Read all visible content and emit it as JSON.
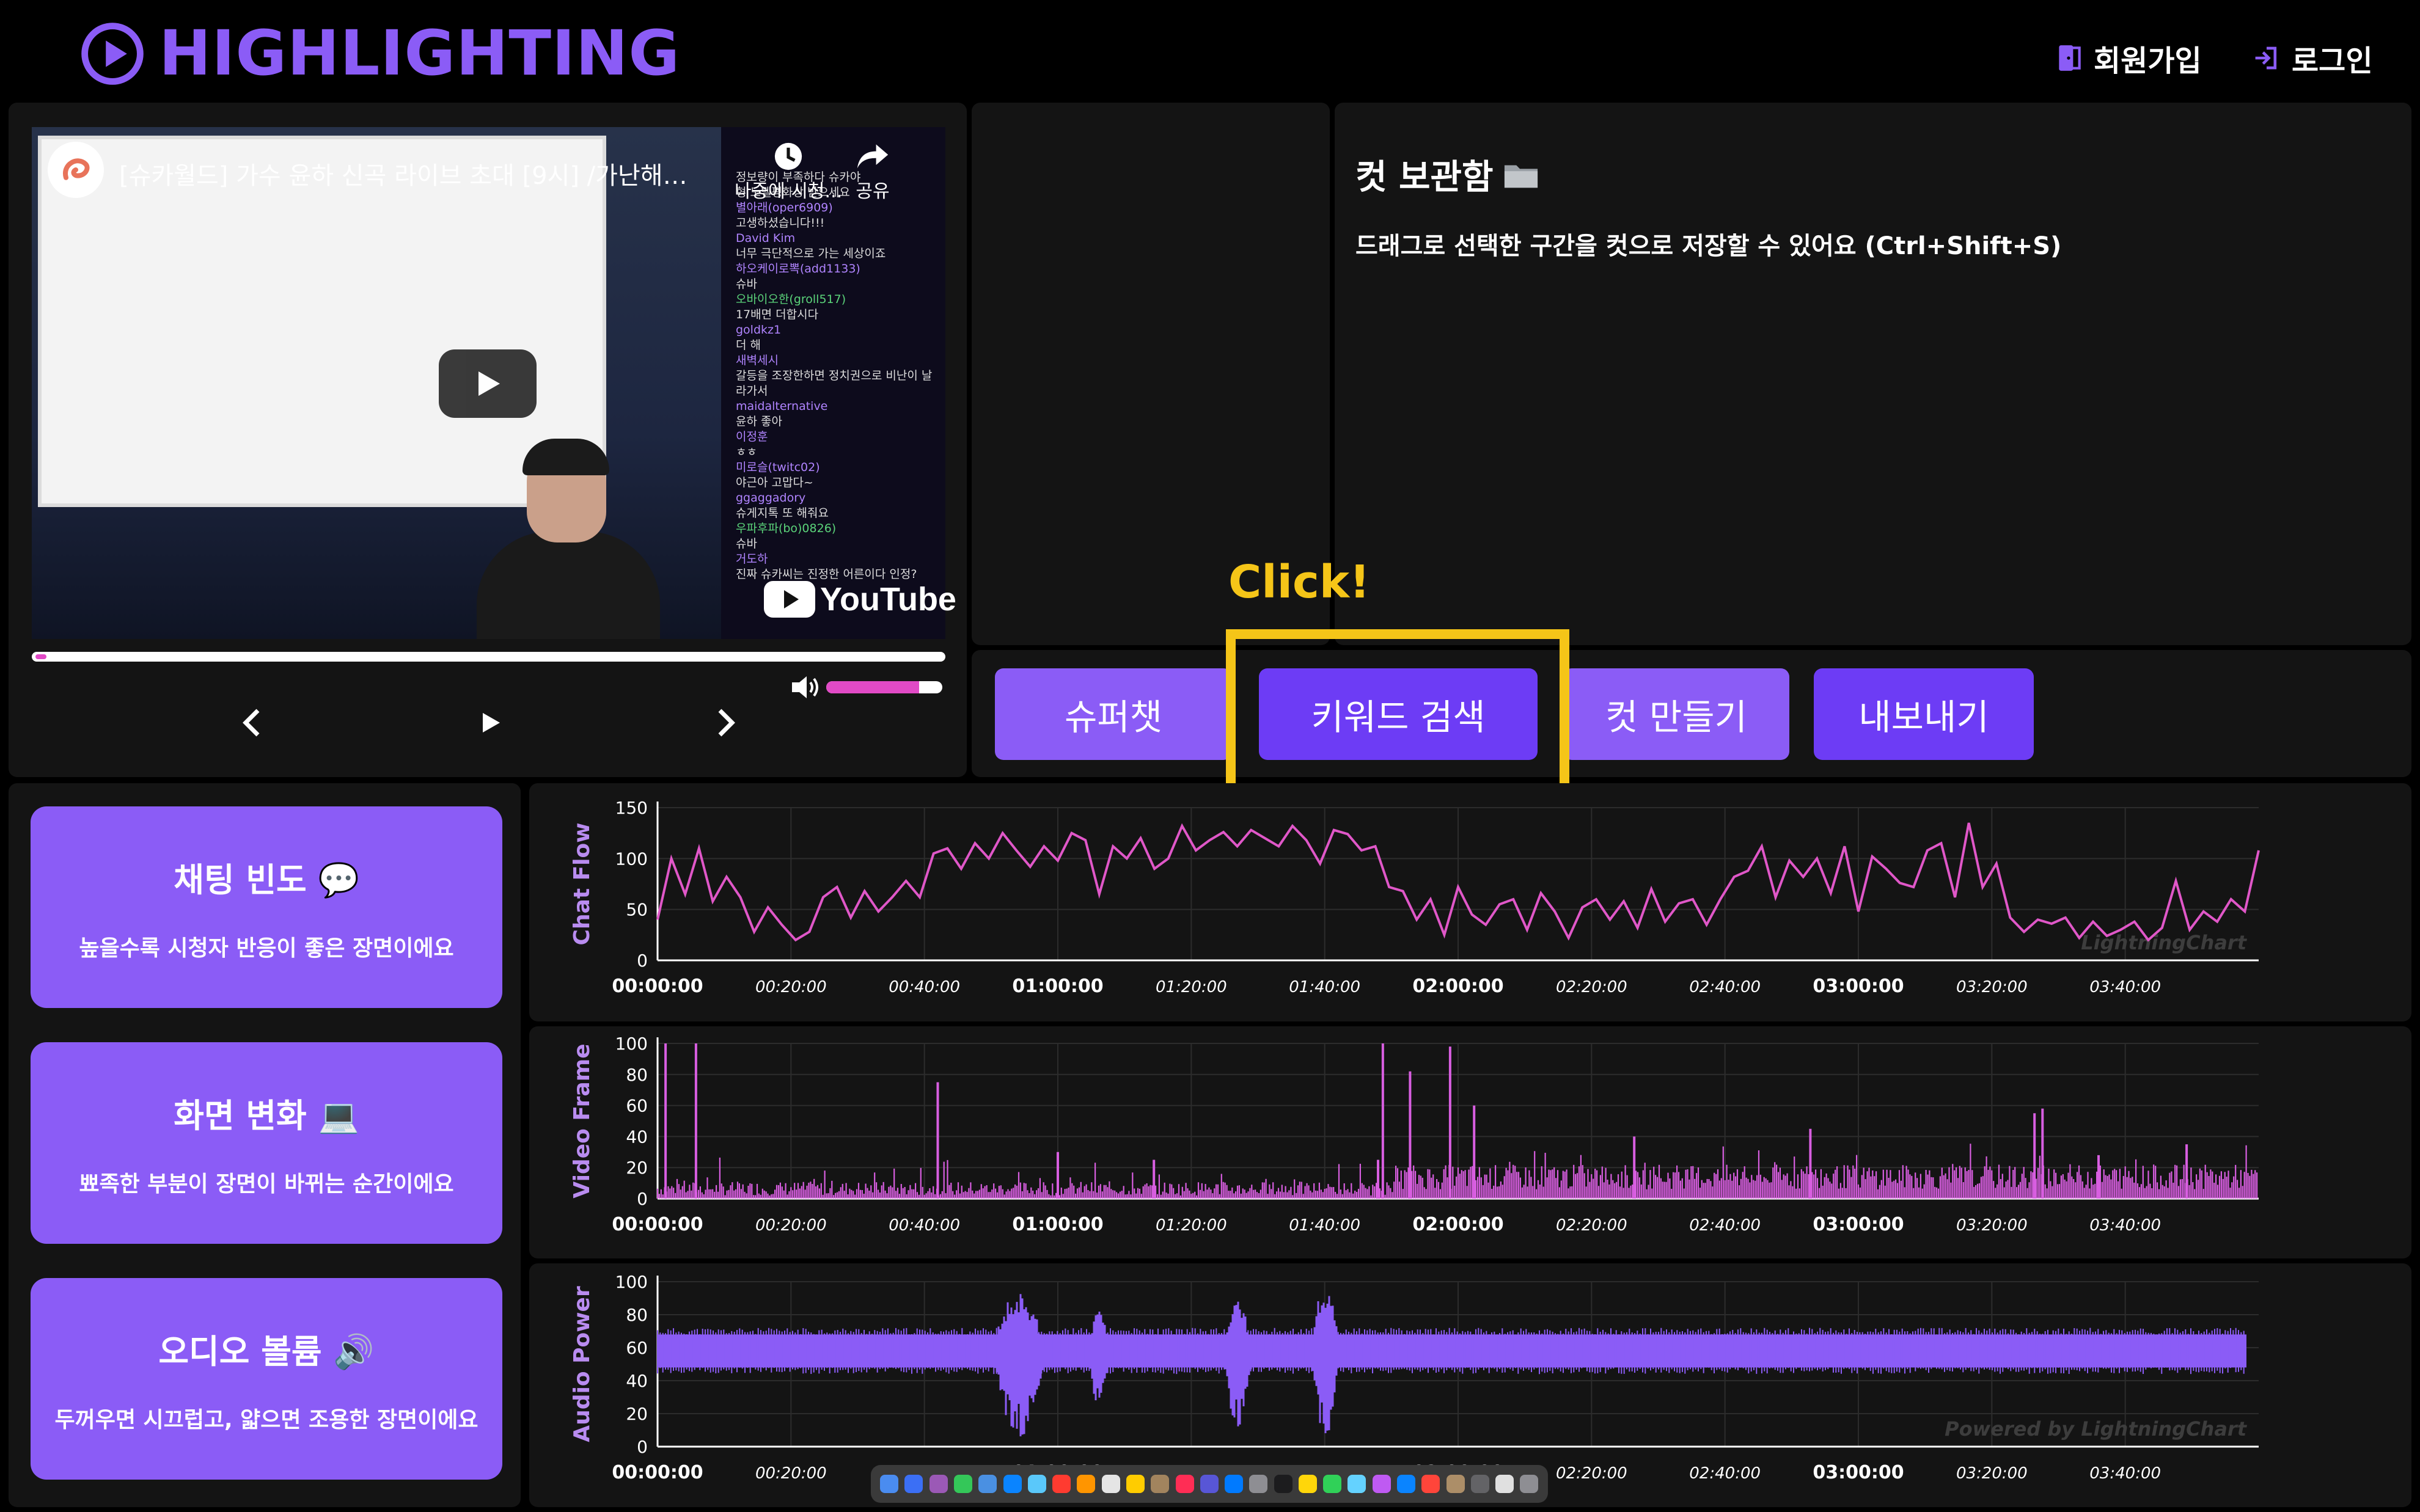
{
  "app": {
    "logo_text": "HIGHLIGHTING"
  },
  "header": {
    "signup_label": "회원가입",
    "login_label": "로그인"
  },
  "video": {
    "title": "[슈카월드] 가수 윤하 신곡 라이브 초대 [9시] /가난해진...",
    "watch_later_label": "나중에 시청...",
    "share_label": "공유",
    "youtube_label": "YouTube",
    "chat_lines": [
      {
        "t": "정보량이 부족하다 슈카야",
        "c": ""
      },
      {
        "t": "형 노벨평화상 받으세요",
        "c": ""
      },
      {
        "t": "별아래(oper6909)",
        "c": "u"
      },
      {
        "t": "고생하셨습니다!!!",
        "c": ""
      },
      {
        "t": "David Kim",
        "c": "u"
      },
      {
        "t": "너무 극단적으로 가는 세상이죠",
        "c": ""
      },
      {
        "t": "하오케이로뽁(add1133)",
        "c": "u"
      },
      {
        "t": "슈바",
        "c": ""
      },
      {
        "t": "오바이오한(groll517)",
        "c": "g"
      },
      {
        "t": "17배면 더합시다",
        "c": ""
      },
      {
        "t": "goldkz1",
        "c": "u"
      },
      {
        "t": "더 해",
        "c": ""
      },
      {
        "t": "새벽세시",
        "c": "u"
      },
      {
        "t": "갈등을 조장한하면 정치권으로 비난이 날라가서",
        "c": ""
      },
      {
        "t": "maidalternative",
        "c": "u"
      },
      {
        "t": "윤하 좋아",
        "c": ""
      },
      {
        "t": "이정훈",
        "c": "u"
      },
      {
        "t": "ㅎㅎ",
        "c": ""
      },
      {
        "t": "미로슬(twitc02)",
        "c": "u"
      },
      {
        "t": "야근아 고맙다~",
        "c": ""
      },
      {
        "t": "ggaggadory",
        "c": "u"
      },
      {
        "t": "슈게지톡 또 해줘요",
        "c": ""
      },
      {
        "t": "우파후파(bo)0826)",
        "c": "g"
      },
      {
        "t": "슈바",
        "c": ""
      },
      {
        "t": "거도하",
        "c": "u"
      },
      {
        "t": "진짜 슈카씨는 진정한 어른이다 인정?",
        "c": ""
      }
    ],
    "volume_level": 0.8,
    "progress": 0.01
  },
  "cut_box": {
    "title": "컷 보관함",
    "description": "드래그로 선택한 구간을 컷으로 저장할 수 있어요 (Ctrl+Shift+S)"
  },
  "actions": {
    "superchat": "슈퍼챗",
    "keyword_search": "키워드 검색",
    "make_cut": "컷 만들기",
    "export": "내보내기",
    "click_hint": "Click!"
  },
  "cards": [
    {
      "title": "채팅 빈도",
      "icon": "💬",
      "desc": "높을수록 시청자 반응이 좋은 장면이에요"
    },
    {
      "title": "화면 변화",
      "icon": "💻",
      "desc": "뾰족한 부분이 장면이 바뀌는 순간이에요"
    },
    {
      "title": "오디오 볼륨",
      "icon": "🔊",
      "desc": "두꺼우면 시끄럽고, 얇으면 조용한 장면이에요"
    }
  ],
  "chart_data": [
    {
      "type": "line",
      "ylabel": "Chat Flow",
      "ylim": [
        0,
        150
      ],
      "yticks": [
        0,
        50,
        100,
        150
      ],
      "x_ticks": [
        "00:00:00",
        "00:20:00",
        "00:40:00",
        "01:00:00",
        "01:20:00",
        "01:40:00",
        "02:00:00",
        "02:20:00",
        "02:40:00",
        "03:00:00",
        "03:20:00",
        "03:40:00"
      ],
      "watermark": "LightningChart",
      "color": "#e057c8",
      "series": [
        {
          "values": [
            40,
            100,
            65,
            110,
            58,
            82,
            62,
            28,
            52,
            35,
            20,
            28,
            62,
            72,
            42,
            68,
            48,
            62,
            78,
            62,
            105,
            110,
            90,
            115,
            100,
            125,
            108,
            92,
            112,
            98,
            125,
            118,
            65,
            112,
            100,
            120,
            90,
            100,
            132,
            108,
            118,
            126,
            112,
            128,
            120,
            112,
            132,
            118,
            95,
            128,
            124,
            108,
            112,
            72,
            68,
            40,
            60,
            25,
            72,
            45,
            35,
            55,
            60,
            30,
            66,
            48,
            22,
            52,
            60,
            40,
            58,
            32,
            70,
            38,
            56,
            60,
            35,
            60,
            82,
            88,
            112,
            62,
            98,
            82,
            100,
            66,
            112,
            48,
            102,
            90,
            76,
            72,
            108,
            115,
            62,
            135,
            72,
            95,
            42,
            28,
            40,
            36,
            42,
            22,
            38,
            24,
            30,
            38,
            20,
            32,
            78,
            30,
            48,
            38,
            60,
            48,
            108
          ]
        }
      ]
    },
    {
      "type": "line",
      "ylabel": "Video Frame",
      "ylim": [
        0,
        100
      ],
      "yticks": [
        0,
        20,
        40,
        60,
        80,
        100
      ],
      "x_ticks": [
        "00:00:00",
        "00:20:00",
        "00:40:00",
        "01:00:00",
        "01:20:00",
        "01:40:00",
        "02:00:00",
        "02:20:00",
        "02:40:00",
        "03:00:00",
        "03:20:00",
        "03:40:00"
      ],
      "color": "#d85ee0",
      "spikes": [
        [
          0.005,
          100
        ],
        [
          0.024,
          100
        ],
        [
          0.175,
          75
        ],
        [
          0.25,
          30
        ],
        [
          0.31,
          25
        ],
        [
          0.45,
          25
        ],
        [
          0.453,
          100
        ],
        [
          0.47,
          82
        ],
        [
          0.495,
          98
        ],
        [
          0.51,
          60
        ],
        [
          0.61,
          40
        ],
        [
          0.72,
          45
        ],
        [
          0.86,
          55
        ],
        [
          0.865,
          58
        ],
        [
          0.9,
          28
        ],
        [
          0.955,
          35
        ]
      ]
    },
    {
      "type": "area",
      "ylabel": "Audio Power",
      "ylim": [
        0,
        100
      ],
      "yticks": [
        0,
        20,
        40,
        60,
        80,
        100
      ],
      "x_ticks": [
        "00:00:00",
        "00:20:00",
        "00:40:00",
        "01:00:00",
        "01:20:00",
        "01:40:00",
        "02:00:00",
        "02:20:00",
        "02:40:00",
        "03:00:00",
        "03:20:00",
        "03:40:00"
      ],
      "watermark": "Powered by LightningChart",
      "color": "#8b5cf6",
      "baseline": 58,
      "band": [
        48,
        68
      ],
      "loud_segments": [
        [
          0.21,
          0.245,
          95,
          5
        ],
        [
          0.27,
          0.285,
          85,
          20
        ],
        [
          0.355,
          0.375,
          88,
          10
        ],
        [
          0.41,
          0.43,
          98,
          5
        ]
      ]
    }
  ]
}
